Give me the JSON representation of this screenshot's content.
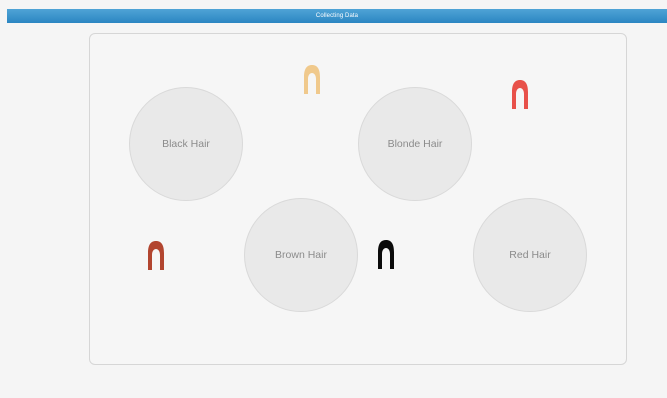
{
  "header": {
    "title": "Collecting Data"
  },
  "bins": [
    {
      "label": "Black Hair"
    },
    {
      "label": "Blonde Hair"
    },
    {
      "label": "Brown Hair"
    },
    {
      "label": "Red Hair"
    }
  ],
  "hair_pieces": [
    {
      "icon": "blonde-hair-icon",
      "color": "#f0c98c"
    },
    {
      "icon": "red-hair-icon",
      "color": "#e8514a"
    },
    {
      "icon": "brown-hair-icon",
      "color": "#b2452f"
    },
    {
      "icon": "black-hair-icon",
      "color": "#0b0b0b"
    }
  ],
  "colors": {
    "header": "#3a95cf",
    "bin_fill": "#e9e9e9",
    "bin_border": "#d9d9d9",
    "board_border": "#d6d6d6"
  }
}
